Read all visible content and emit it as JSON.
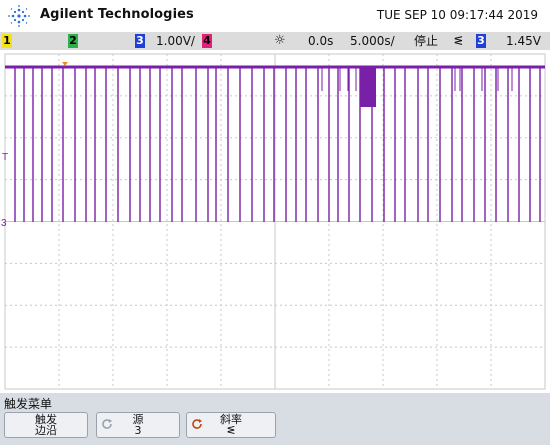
{
  "header": {
    "brand": "Agilent Technologies",
    "datetime": "TUE SEP 10 09:17:44 2019"
  },
  "status": {
    "ch1": "1",
    "ch2": "2",
    "ch3": "3",
    "ch3_scale": "1.00V/",
    "ch4": "4",
    "time_offset": "0.0s",
    "time_scale": "5.000s/",
    "run_state": "停止",
    "trigger_source": "3",
    "trigger_level": "1.45V"
  },
  "markers": {
    "trigger_marker": "T",
    "ch3_marker": "3"
  },
  "menu": {
    "title": "触发菜单",
    "keys": [
      {
        "top": "触发",
        "bottom": "边沿"
      },
      {
        "top": "源",
        "bottom": "3"
      },
      {
        "top": "斜率",
        "bottom": "ᓬ"
      }
    ]
  },
  "colors": {
    "ch1": "#f2e21a",
    "ch2": "#2db04b",
    "ch3": "#1f3fd6",
    "ch4": "#e0207a",
    "trace": "#7a1fa8",
    "grid": "#c8c8c8"
  }
}
